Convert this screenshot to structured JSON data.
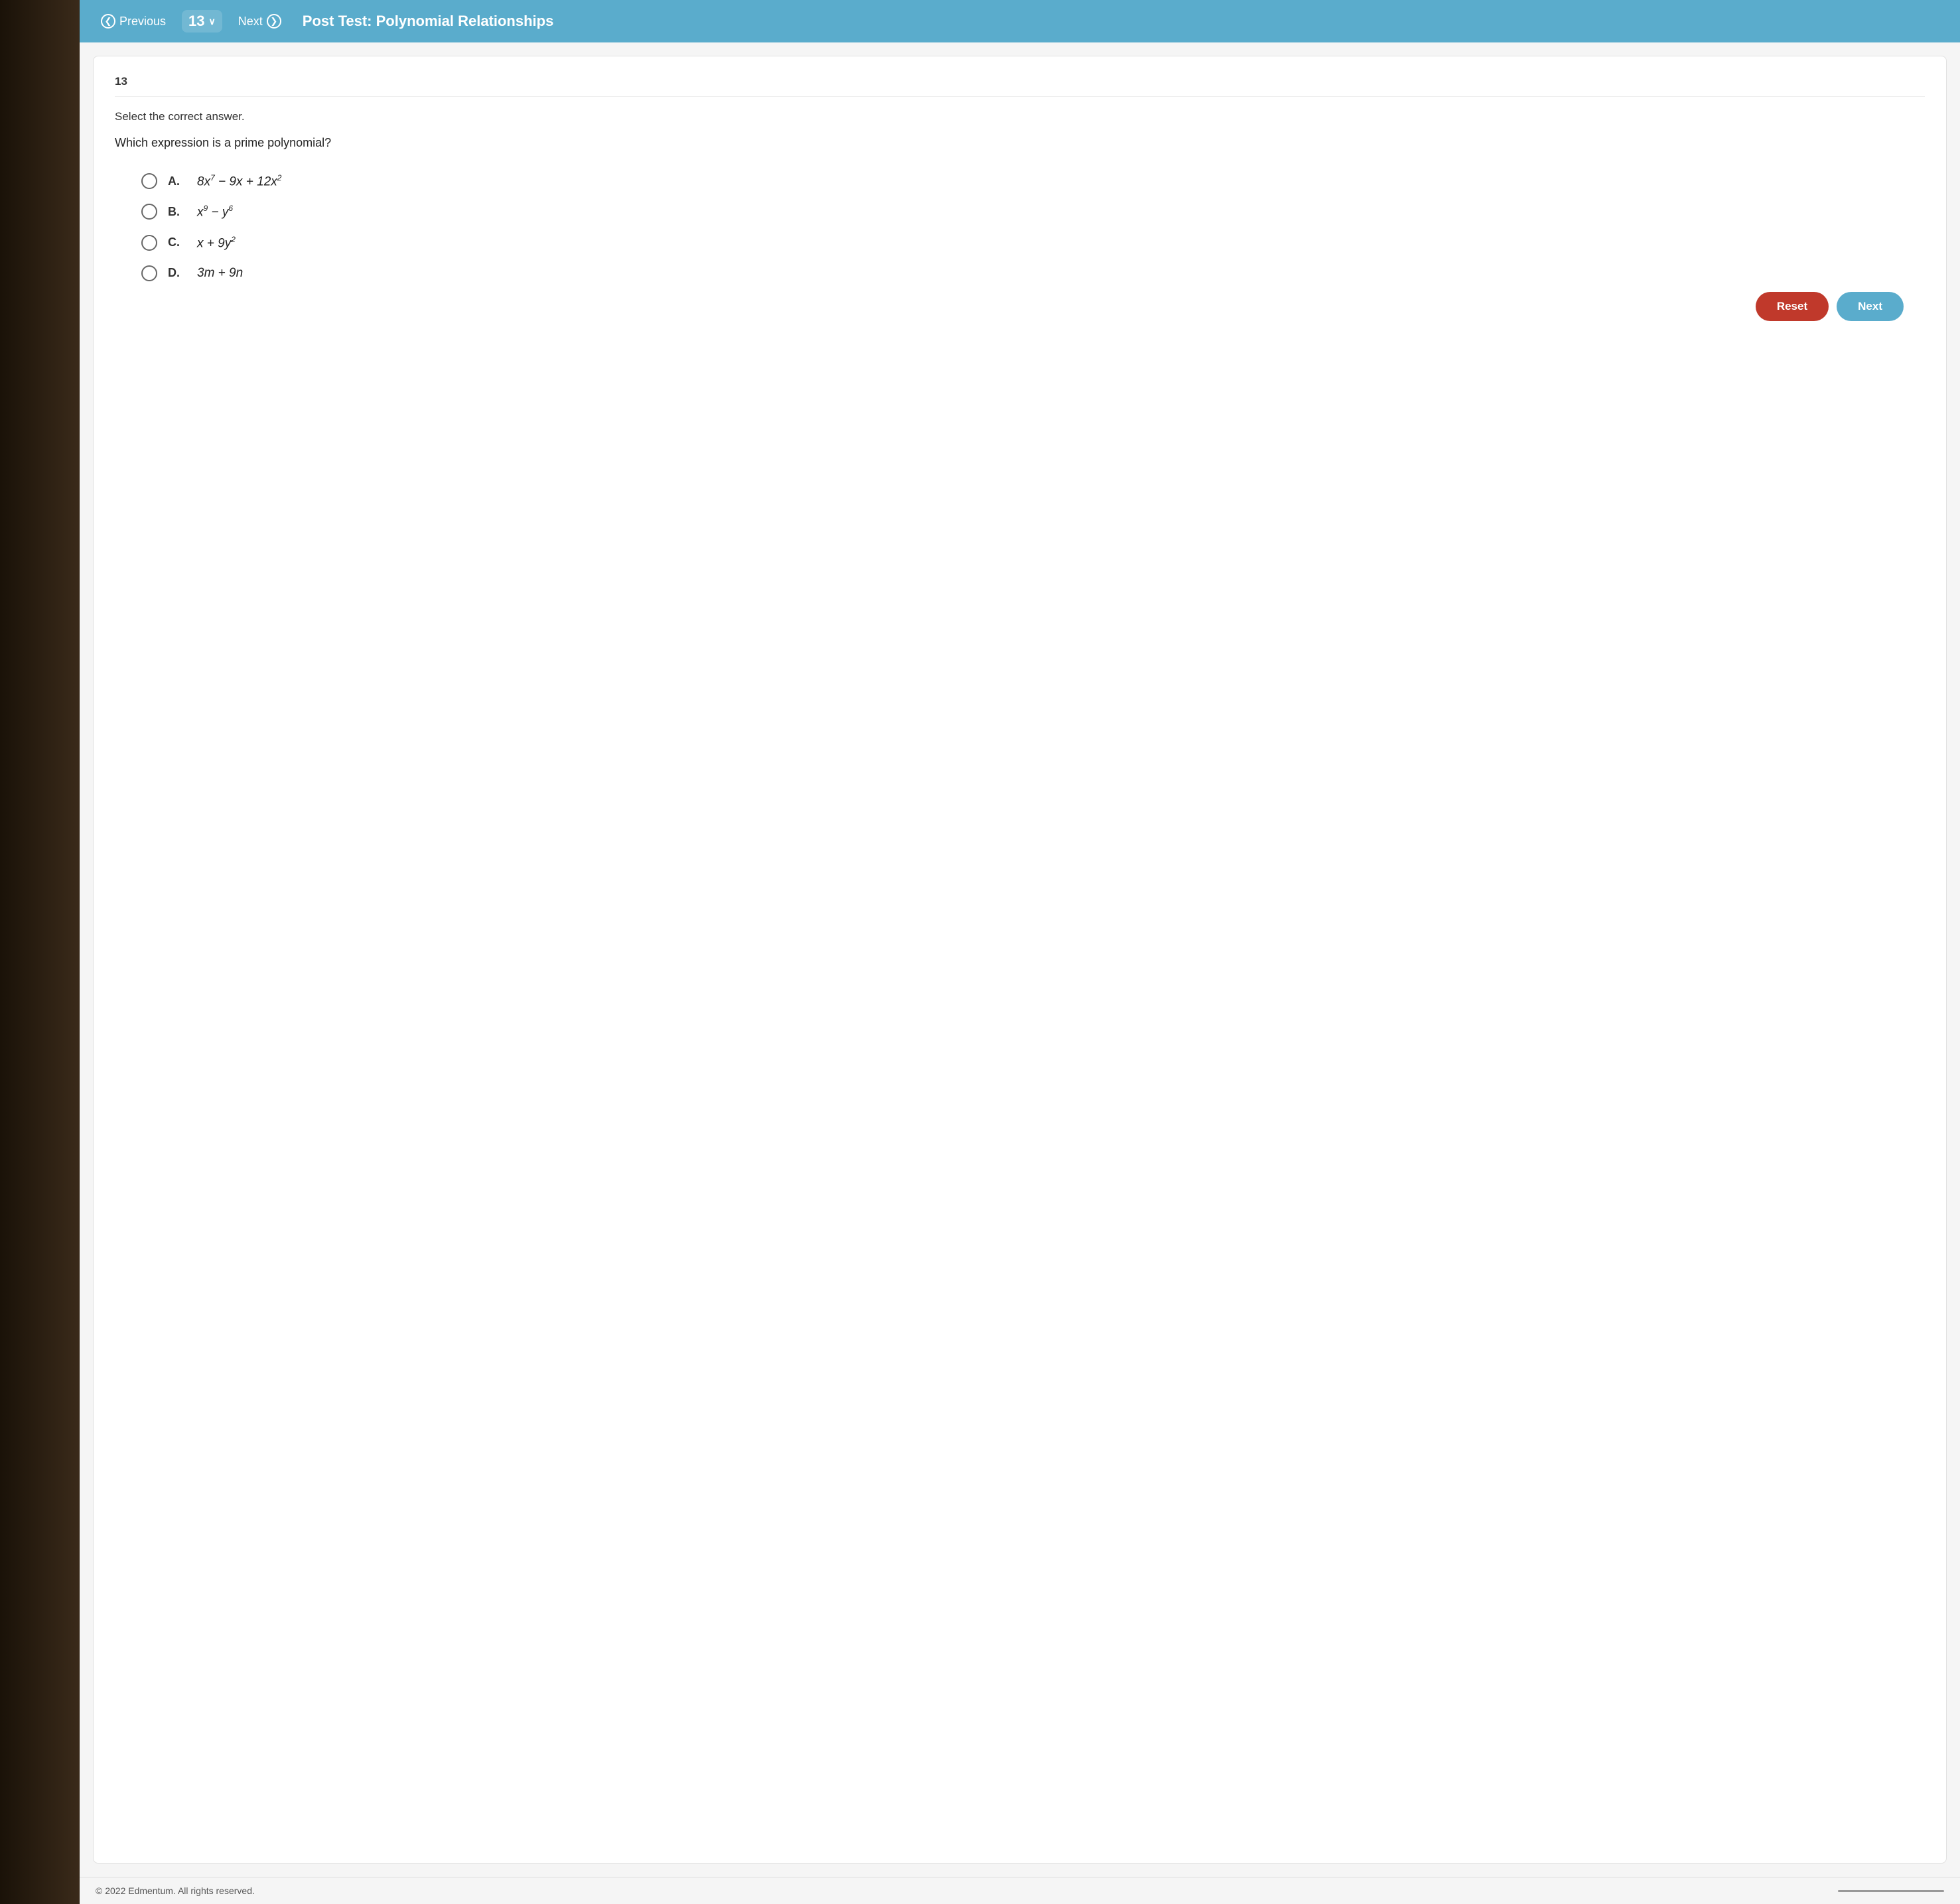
{
  "nav": {
    "previous_label": "Previous",
    "next_label": "Next",
    "question_number": "13",
    "chevron": "✓",
    "title": "Post Test: Polynomial Relationships"
  },
  "question": {
    "number": "13",
    "instruction": "Select the correct answer.",
    "question_text": "Which expression is a prime polynomial?",
    "options": [
      {
        "id": "A",
        "label": "A.",
        "expression": "8x⁷ − 9x + 12x²"
      },
      {
        "id": "B",
        "label": "B.",
        "expression": "x⁹ − y⁶"
      },
      {
        "id": "C",
        "label": "C.",
        "expression": "x + 9y²"
      },
      {
        "id": "D",
        "label": "D.",
        "expression": "3m + 9n"
      }
    ]
  },
  "buttons": {
    "reset": "Reset",
    "next": "Next"
  },
  "footer": {
    "copyright": "© 2022 Edmentum. All rights reserved."
  },
  "icons": {
    "arrow_left": "❮",
    "arrow_right": "❯",
    "chevron_down": "∨"
  }
}
